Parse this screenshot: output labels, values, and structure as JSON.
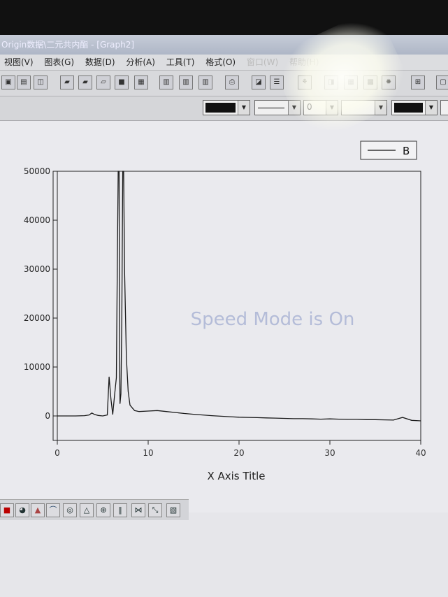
{
  "window": {
    "title": "Origin数据\\二元共内酯 - [Graph2]"
  },
  "menu": {
    "items": [
      "视图(V)",
      "图表(G)",
      "数据(D)",
      "分析(A)",
      "工具(T)",
      "格式(O)",
      "窗口(W)",
      "帮助(H)"
    ]
  },
  "toolbar1": {
    "icons": [
      "new-graph-icon",
      "new-layout-icon",
      "new-function-icon",
      "open-icon",
      "open-template-icon",
      "import-icon",
      "save-icon",
      "save-template-icon",
      "import-ascii-icon",
      "import-multi-ascii-icon",
      "import-thermo-icon",
      "print-icon",
      "refresh-icon",
      "duplicate-icon",
      "layer-properties-icon",
      "zoom-icon",
      "worksheet-icon",
      "matrix-icon",
      "code-builder-icon",
      "add-layer-icon",
      "new-window-icon"
    ]
  },
  "toolbar2": {
    "line_width_value": "0"
  },
  "graph": {
    "legend_label": "B",
    "watermark": "Speed Mode is On"
  },
  "chart_data": {
    "type": "line",
    "xlabel": "X Axis Title",
    "ylabel": "",
    "xlim": [
      0,
      40
    ],
    "ylim": [
      -5000,
      50000
    ],
    "x_ticks": [
      "0",
      "10",
      "20",
      "30",
      "40"
    ],
    "y_ticks": [
      "0",
      "10000",
      "20000",
      "30000",
      "40000",
      "50000"
    ],
    "series": [
      {
        "name": "B",
        "x": [
          0,
          1,
          2,
          3,
          3.5,
          3.8,
          4.1,
          4.5,
          5,
          5.5,
          5.7,
          5.9,
          6.1,
          6.3,
          6.5,
          6.6,
          6.7,
          6.8,
          6.85,
          6.9,
          7.0,
          7.1,
          7.2,
          7.3,
          7.4,
          7.6,
          7.8,
          8.0,
          8.5,
          9,
          10,
          11,
          12,
          13,
          14,
          15,
          16,
          17,
          18,
          19,
          20,
          21,
          22,
          23,
          24,
          25,
          26,
          27,
          28,
          29,
          30,
          31,
          32,
          33,
          34,
          35,
          36,
          37,
          38,
          39,
          40
        ],
        "y": [
          0,
          0,
          0,
          50,
          200,
          600,
          300,
          100,
          0,
          200,
          8000,
          3500,
          300,
          4200,
          7800,
          30000,
          50000,
          50000,
          12000,
          2500,
          4500,
          20000,
          50000,
          50000,
          30000,
          12000,
          5000,
          2200,
          1100,
          900,
          1000,
          1100,
          900,
          700,
          500,
          350,
          200,
          50,
          -50,
          -150,
          -250,
          -300,
          -350,
          -400,
          -450,
          -500,
          -550,
          -550,
          -600,
          -650,
          -600,
          -650,
          -700,
          -700,
          -750,
          -750,
          -800,
          -850,
          -300,
          -900,
          -1000
        ]
      }
    ],
    "grid": false,
    "legend_position": "top-right"
  },
  "bottom_toolbar": {
    "icons": [
      "color-fill-icon",
      "pie-chart-icon",
      "area-chart-icon",
      "contour-icon",
      "polar-icon",
      "ternary-icon",
      "3d-pie-icon",
      "bar-stack-icon",
      "error-bar-icon",
      "vector-icon",
      "template-icon"
    ]
  }
}
